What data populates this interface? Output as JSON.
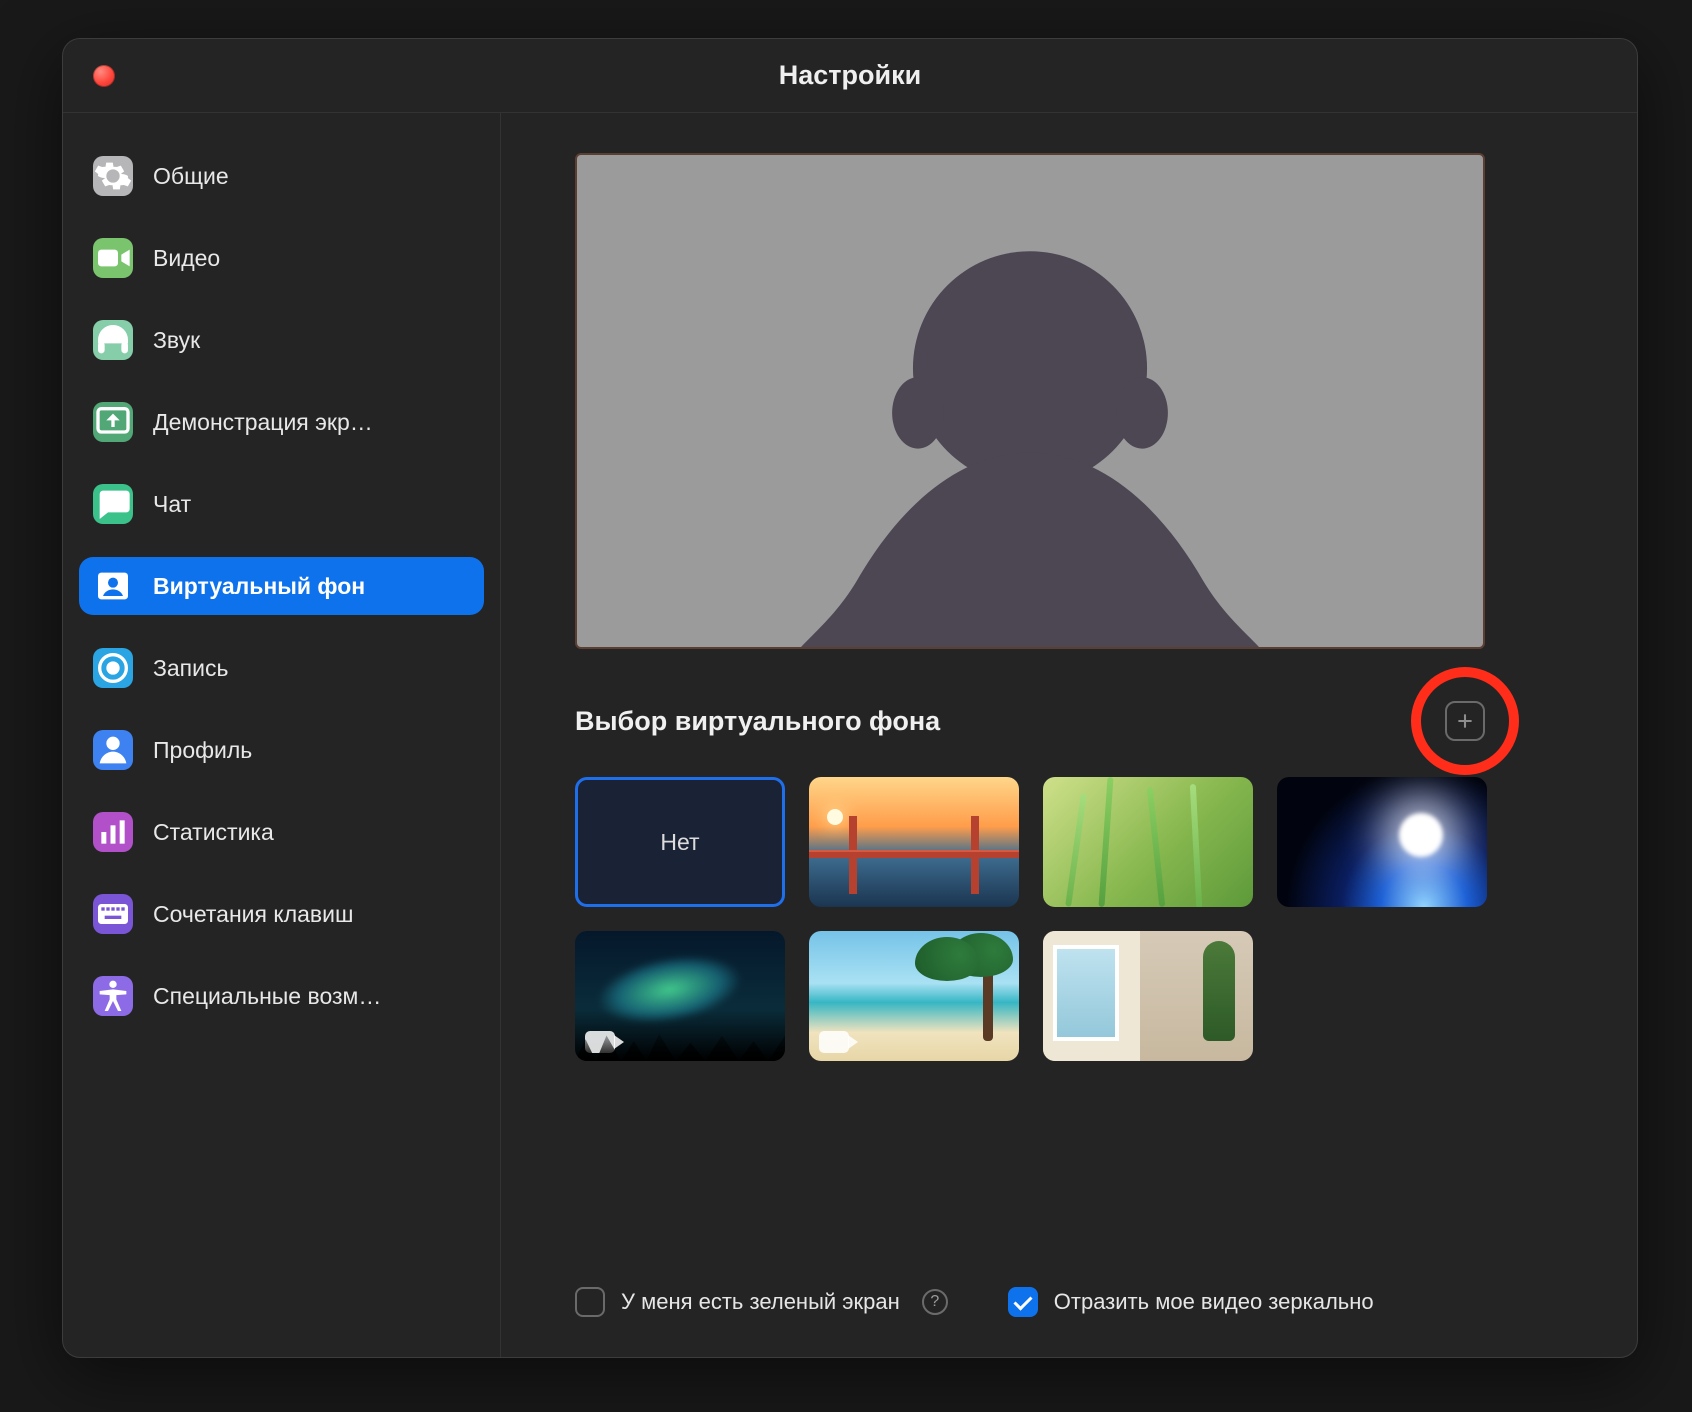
{
  "window": {
    "title": "Настройки"
  },
  "sidebar": {
    "items": [
      {
        "id": "general",
        "label": "Общие",
        "icon": "gear",
        "color": "#b6b6b8"
      },
      {
        "id": "video",
        "label": "Видео",
        "icon": "video",
        "color": "#7ac46d"
      },
      {
        "id": "audio",
        "label": "Звук",
        "icon": "headphones",
        "color": "#86ceaa"
      },
      {
        "id": "share",
        "label": "Демонстрация экр…",
        "icon": "screen-up",
        "color": "#52a777"
      },
      {
        "id": "chat",
        "label": "Чат",
        "icon": "chat",
        "color": "#3bc18a"
      },
      {
        "id": "vbg",
        "label": "Виртуальный фон",
        "icon": "person-card",
        "color": "#0e72ed",
        "selected": true
      },
      {
        "id": "recording",
        "label": "Запись",
        "icon": "record",
        "color": "#2aa4e3"
      },
      {
        "id": "profile",
        "label": "Профиль",
        "icon": "person",
        "color": "#3d82f0"
      },
      {
        "id": "stats",
        "label": "Статистика",
        "icon": "bars",
        "color": "#b150c8"
      },
      {
        "id": "shortcuts",
        "label": "Сочетания клавиш",
        "icon": "keyboard",
        "color": "#7a56d6"
      },
      {
        "id": "access",
        "label": "Специальные возм…",
        "icon": "accessibility",
        "color": "#8e6be6"
      }
    ]
  },
  "content": {
    "section_title": "Выбор виртуального фона",
    "backgrounds": [
      {
        "id": "none",
        "label": "Нет",
        "selected": true
      },
      {
        "id": "bridge",
        "video": false
      },
      {
        "id": "grass",
        "video": false
      },
      {
        "id": "earth",
        "video": false
      },
      {
        "id": "aurora",
        "video": true
      },
      {
        "id": "beach",
        "video": true
      },
      {
        "id": "room",
        "video": false
      }
    ],
    "green_screen": {
      "label": "У меня есть зеленый экран",
      "checked": false
    },
    "mirror": {
      "label": "Отразить мое видео зеркально",
      "checked": true
    }
  }
}
